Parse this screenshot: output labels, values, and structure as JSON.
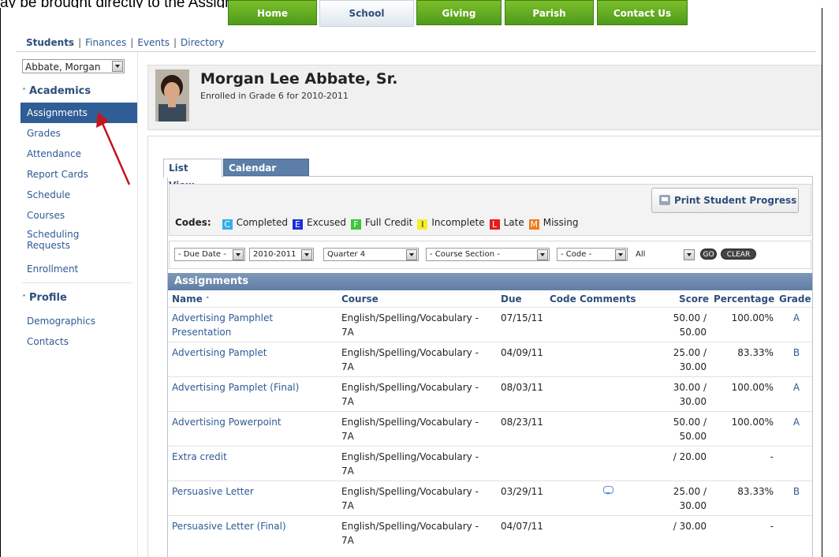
{
  "caption": "ay be brought directly to the Assignments page.",
  "top_tabs": [
    "Home",
    "School",
    "Giving",
    "Parish",
    "Contact Us"
  ],
  "sub_nav": {
    "students": "Students",
    "finances": "Finances",
    "events": "Events",
    "directory": "Directory",
    "sep": "|"
  },
  "sidebar": {
    "student_select": "Abbate, Morgan",
    "academics_heading": "Academics",
    "academics_items": [
      "Assignments",
      "Grades",
      "Attendance",
      "Report Cards",
      "Schedule",
      "Courses",
      "Scheduling Requests",
      "Enrollment"
    ],
    "profile_heading": "Profile",
    "profile_items": [
      "Demographics",
      "Contacts"
    ]
  },
  "student": {
    "name": "Morgan Lee Abbate, Sr.",
    "enrollment": "Enrolled in Grade 6 for 2010-2011"
  },
  "view_tabs": {
    "list": "List View",
    "calendar": "Calendar View"
  },
  "print_button": "Print Student Progress",
  "codes": {
    "label": "Codes:",
    "items": [
      {
        "code": "C",
        "label": "Completed",
        "color": "#33aee8"
      },
      {
        "code": "E",
        "label": "Excused",
        "color": "#1a2fd6"
      },
      {
        "code": "F",
        "label": "Full Credit",
        "color": "#3ac43a"
      },
      {
        "code": "I",
        "label": "Incomplete",
        "color": "#f4ee2a"
      },
      {
        "code": "L",
        "label": "Late",
        "color": "#e41d1d"
      },
      {
        "code": "M",
        "label": "Missing",
        "color": "#ef7a1c"
      }
    ]
  },
  "filters": {
    "due_date": "- Due Date -",
    "year": "2010-2011",
    "quarter": "Quarter 4",
    "course_section": "- Course Section -",
    "code": "- Code -",
    "all": "All",
    "go": "GO",
    "clear": "CLEAR"
  },
  "table": {
    "title": "Assignments",
    "headers": {
      "name": "Name",
      "course": "Course",
      "due": "Due",
      "code_comments": "Code Comments",
      "score": "Score",
      "percentage": "Percentage",
      "grade": "Grade"
    },
    "sort_icon": "sort-up-icon",
    "rows": [
      {
        "name": "Advertising Pamphlet Presentation",
        "course": "English/Spelling/Vocabulary - 7A",
        "due": "07/15/11",
        "comment": false,
        "score": "50.00 / 50.00",
        "percentage": "100.00%",
        "grade": "A"
      },
      {
        "name": "Advertising Pamplet",
        "course": "English/Spelling/Vocabulary - 7A",
        "due": "04/09/11",
        "comment": false,
        "score": "25.00 / 30.00",
        "percentage": "83.33%",
        "grade": "B"
      },
      {
        "name": "Advertising Pamplet (Final)",
        "course": "English/Spelling/Vocabulary - 7A",
        "due": "08/03/11",
        "comment": false,
        "score": "30.00 / 30.00",
        "percentage": "100.00%",
        "grade": "A"
      },
      {
        "name": "Advertising Powerpoint",
        "course": "English/Spelling/Vocabulary - 7A",
        "due": "08/23/11",
        "comment": false,
        "score": "50.00 / 50.00",
        "percentage": "100.00%",
        "grade": "A"
      },
      {
        "name": "Extra credit",
        "course": "English/Spelling/Vocabulary - 7A",
        "due": "",
        "comment": false,
        "score": "/ 20.00",
        "percentage": "-",
        "grade": ""
      },
      {
        "name": "Persuasive Letter",
        "course": "English/Spelling/Vocabulary - 7A",
        "due": "03/29/11",
        "comment": true,
        "score": "25.00 / 30.00",
        "percentage": "83.33%",
        "grade": "B"
      },
      {
        "name": "Persuasive Letter (Final)",
        "course": "English/Spelling/Vocabulary - 7A",
        "due": "04/07/11",
        "comment": false,
        "score": "/ 30.00",
        "percentage": "-",
        "grade": ""
      }
    ]
  }
}
